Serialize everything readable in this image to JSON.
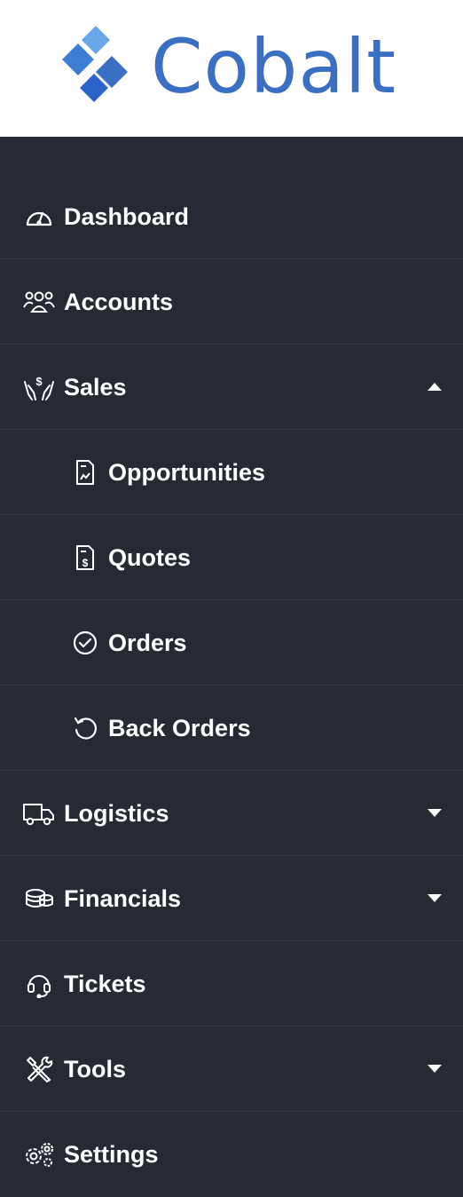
{
  "brand": {
    "name": "Cobalt",
    "color": "#3a6fc4"
  },
  "colors": {
    "sidebar_bg": "#252a33",
    "divider": "#363c47",
    "text": "#ffffff"
  },
  "nav": {
    "items": [
      {
        "label": "Dashboard",
        "icon": "gauge-icon"
      },
      {
        "label": "Accounts",
        "icon": "users-icon"
      },
      {
        "label": "Sales",
        "icon": "hand-dollar-icon",
        "expanded": true,
        "children": [
          {
            "label": "Opportunities",
            "icon": "document-chart-icon"
          },
          {
            "label": "Quotes",
            "icon": "document-dollar-icon"
          },
          {
            "label": "Orders",
            "icon": "check-circle-icon"
          },
          {
            "label": "Back Orders",
            "icon": "undo-icon"
          }
        ]
      },
      {
        "label": "Logistics",
        "icon": "truck-icon",
        "expanded": false
      },
      {
        "label": "Financials",
        "icon": "coins-icon",
        "expanded": false
      },
      {
        "label": "Tickets",
        "icon": "headset-icon"
      },
      {
        "label": "Tools",
        "icon": "tools-icon",
        "expanded": false
      },
      {
        "label": "Settings",
        "icon": "gears-icon"
      }
    ]
  }
}
